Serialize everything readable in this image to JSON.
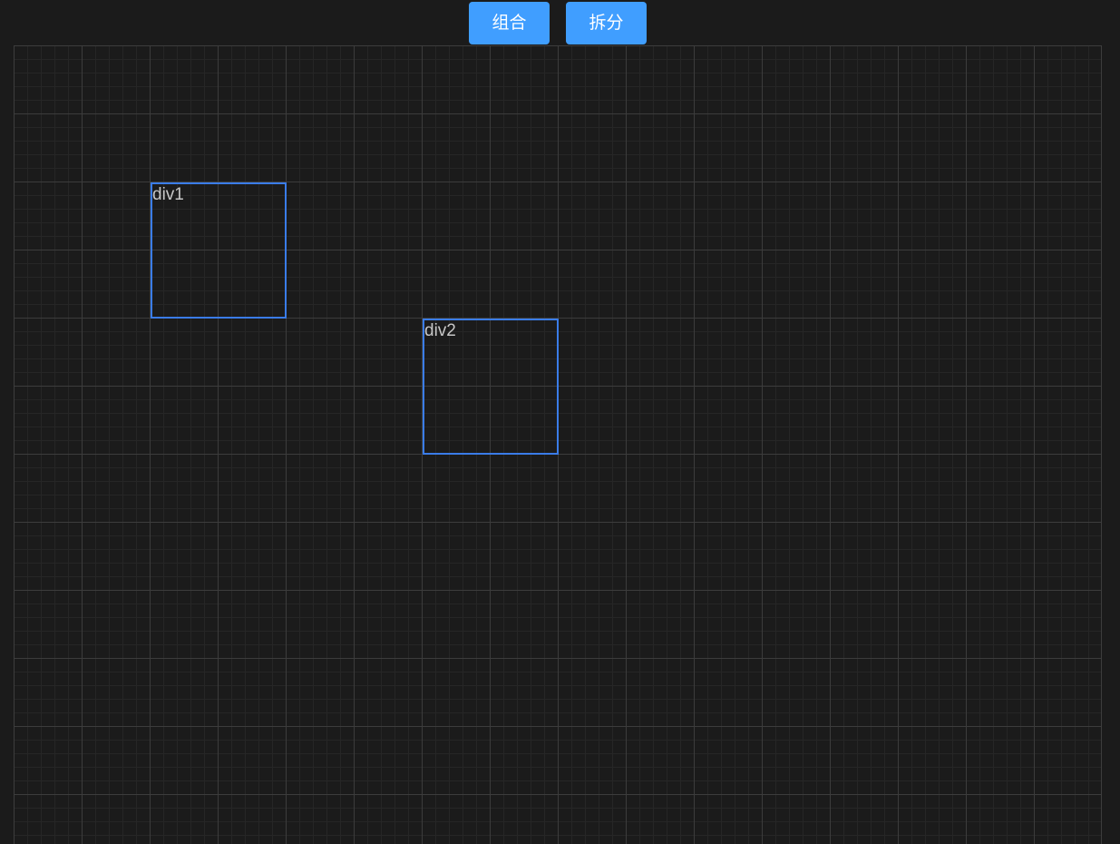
{
  "toolbar": {
    "combine_label": "组合",
    "split_label": "拆分",
    "button_color": "#409eff"
  },
  "canvas": {
    "background": "#1b1b1b",
    "grid_major_color": "#3c3c3c",
    "grid_minor_color": "#262626",
    "boxes": [
      {
        "label": "div1",
        "border_color": "#3a7ce8"
      },
      {
        "label": "div2",
        "border_color": "#3a7ce8"
      }
    ]
  }
}
